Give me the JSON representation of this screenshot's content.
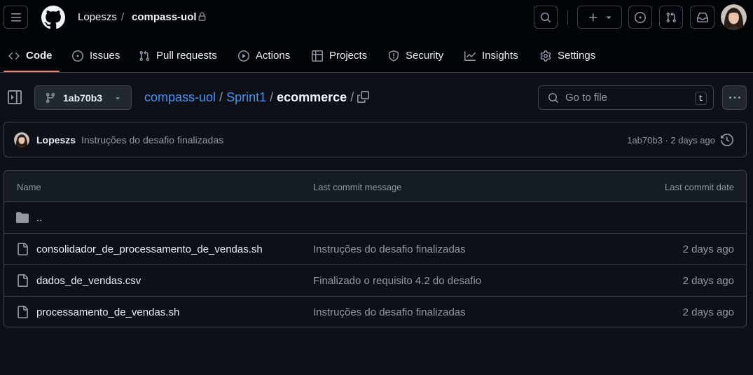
{
  "header": {
    "owner": "Lopeszs",
    "separator": "/",
    "repo": "compass-uol"
  },
  "nav": {
    "tabs": [
      {
        "label": "Code",
        "icon": "code-icon",
        "active": true
      },
      {
        "label": "Issues",
        "icon": "issue-opened-icon"
      },
      {
        "label": "Pull requests",
        "icon": "git-pull-request-icon"
      },
      {
        "label": "Actions",
        "icon": "play-icon"
      },
      {
        "label": "Projects",
        "icon": "table-icon"
      },
      {
        "label": "Security",
        "icon": "shield-icon"
      },
      {
        "label": "Insights",
        "icon": "graph-icon"
      },
      {
        "label": "Settings",
        "icon": "gear-icon"
      }
    ]
  },
  "branch": {
    "label": "1ab70b3"
  },
  "path": {
    "segments": [
      "compass-uol",
      "Sprint1"
    ],
    "current": "ecommerce",
    "separator": "/"
  },
  "goto": {
    "placeholder": "Go to file",
    "shortcut": "t"
  },
  "commit": {
    "author": "Lopeszs",
    "message": "Instruções do desafio finalizadas",
    "meta": "1ab70b3 · 2 days ago"
  },
  "table": {
    "headers": {
      "name": "Name",
      "message": "Last commit message",
      "date": "Last commit date"
    },
    "parent": "..",
    "rows": [
      {
        "name": "consolidador_de_processamento_de_vendas.sh",
        "message": "Instruções do desafio finalizadas",
        "date": "2 days ago"
      },
      {
        "name": "dados_de_vendas.csv",
        "message": "Finalizado o requisito 4.2 do desafio",
        "date": "2 days ago"
      },
      {
        "name": "processamento_de_vendas.sh",
        "message": "Instruções do desafio finalizadas",
        "date": "2 days ago"
      }
    ]
  },
  "colors": {
    "background": "#0d1117",
    "header": "#010409",
    "accent_link": "#4493f8",
    "active_underline": "#f78166",
    "border": "#3d444d",
    "muted_text": "#9198a1"
  }
}
